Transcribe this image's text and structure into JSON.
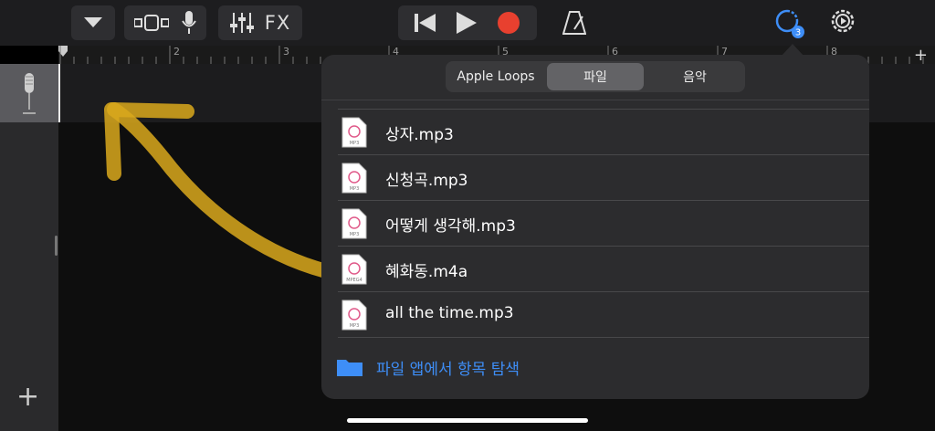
{
  "toolbar": {
    "fx_label": "FX",
    "loops_badge": "3"
  },
  "ruler": {
    "numbers": [
      "2",
      "3",
      "4",
      "5",
      "6",
      "7",
      "8"
    ]
  },
  "browser": {
    "tabs": [
      {
        "label": "Apple Loops",
        "active": false
      },
      {
        "label": "파일",
        "active": true
      },
      {
        "label": "음악",
        "active": false
      }
    ],
    "files": [
      {
        "name": "상자.mp3",
        "type": "MP3"
      },
      {
        "name": "신청곡.mp3",
        "type": "MP3"
      },
      {
        "name": "어떻게 생각해.mp3",
        "type": "MP3"
      },
      {
        "name": "혜화동.m4a",
        "type": "MPEG4"
      },
      {
        "name": "all the time.mp3",
        "type": "MP3"
      }
    ],
    "browse_label": "파일 앱에서 항목 탐색"
  },
  "colors": {
    "accent_blue": "#3e8ef7",
    "record_red": "#e8402f",
    "highlighter": "#d9a81c"
  }
}
